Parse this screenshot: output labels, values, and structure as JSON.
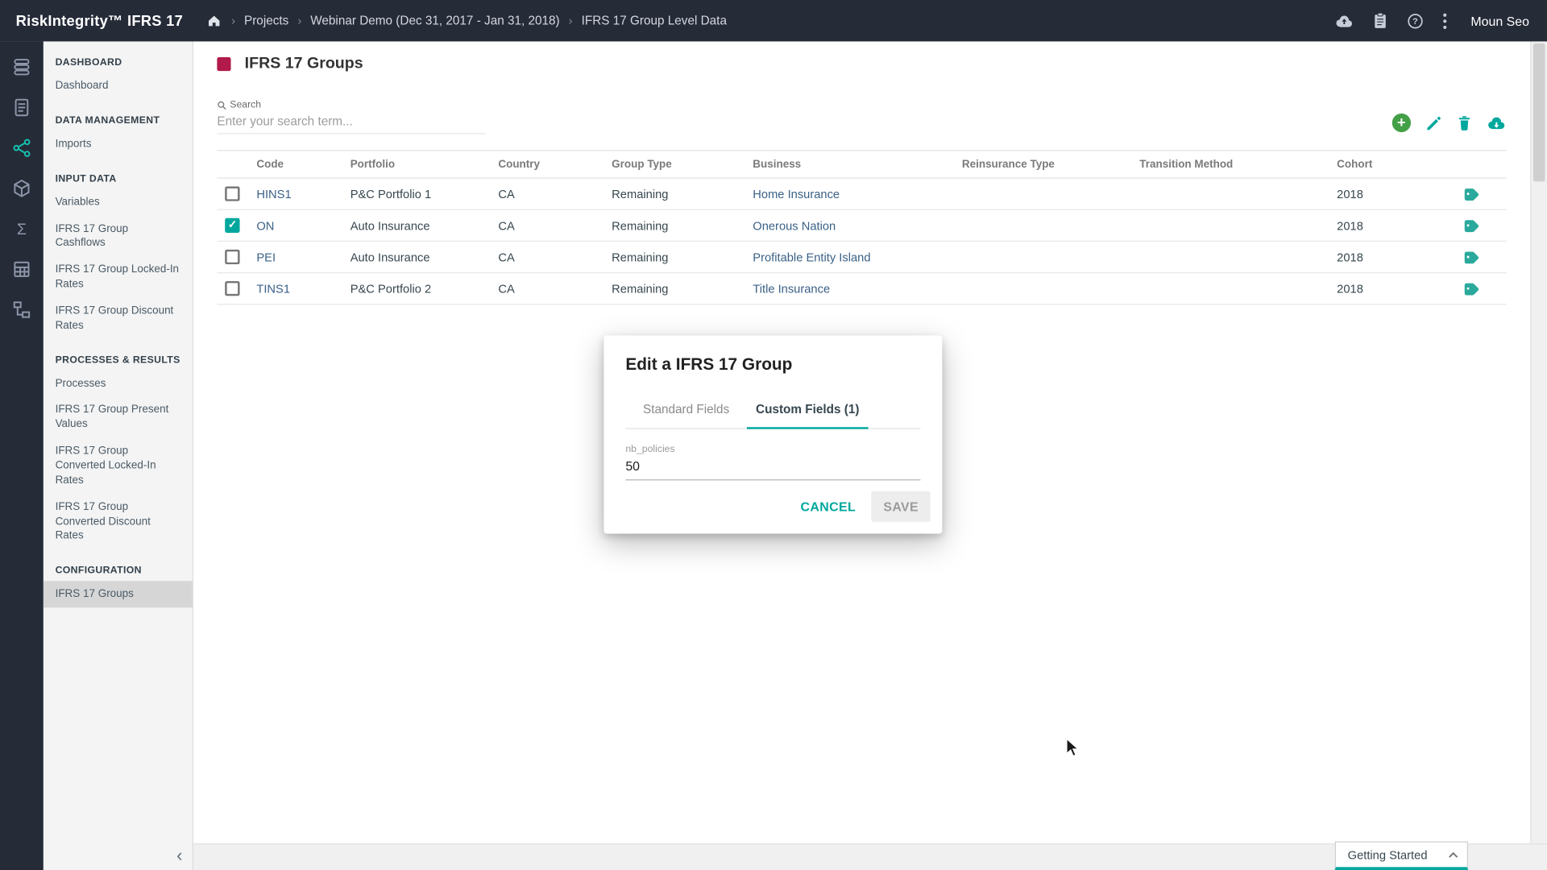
{
  "topbar": {
    "brand": "RiskIntegrity™ IFRS 17",
    "breadcrumb": [
      "Projects",
      "Webinar Demo (Dec 31, 2017 - Jan 31, 2018)",
      "IFRS 17 Group Level Data"
    ],
    "user": "Moun Seo",
    "icons": [
      "home-icon",
      "cloud-upload-icon",
      "clipboard-icon",
      "help-icon",
      "more-vertical-icon"
    ]
  },
  "rail": {
    "icons": [
      "data-sources-icon",
      "reports-icon",
      "data-management-icon",
      "input-data-icon",
      "sum-icon",
      "tables-icon",
      "workflow-icon"
    ],
    "active": "data-management-icon"
  },
  "sidebar": {
    "selected": "IFRS 17 Groups",
    "sections": [
      {
        "header": "DASHBOARD",
        "items": [
          "Dashboard"
        ]
      },
      {
        "header": "DATA MANAGEMENT",
        "items": [
          "Imports"
        ]
      },
      {
        "header": "INPUT DATA",
        "items": [
          "Variables",
          "IFRS 17 Group Cashflows",
          "IFRS 17 Group Locked-In Rates",
          "IFRS 17 Group Discount Rates"
        ]
      },
      {
        "header": "PROCESSES & RESULTS",
        "items": [
          "Processes",
          "IFRS 17 Group Present Values",
          "IFRS 17 Group Converted Locked-In Rates",
          "IFRS 17 Group Converted Discount Rates"
        ]
      },
      {
        "header": "CONFIGURATION",
        "items": [
          "IFRS 17 Groups"
        ]
      }
    ]
  },
  "page": {
    "title": "IFRS 17 Groups",
    "search_label": "Search",
    "search_placeholder": "Enter your search term...",
    "actions": [
      "add-button",
      "edit-button",
      "delete-button",
      "export-button"
    ]
  },
  "table": {
    "headers": [
      "Code",
      "Portfolio",
      "Country",
      "Group Type",
      "Business",
      "Reinsurance Type",
      "Transition Method",
      "Cohort"
    ],
    "rows": [
      {
        "checked": false,
        "code": "HINS1",
        "portfolio": "P&C Portfolio 1",
        "country": "CA",
        "group_type": "Remaining",
        "business": "Home Insurance",
        "reinsurance_type": "",
        "transition_method": "",
        "cohort": "2018"
      },
      {
        "checked": true,
        "code": "ON",
        "portfolio": "Auto Insurance",
        "country": "CA",
        "group_type": "Remaining",
        "business": "Onerous Nation",
        "reinsurance_type": "",
        "transition_method": "",
        "cohort": "2018"
      },
      {
        "checked": false,
        "code": "PEI",
        "portfolio": "Auto Insurance",
        "country": "CA",
        "group_type": "Remaining",
        "business": "Profitable Entity Island",
        "reinsurance_type": "",
        "transition_method": "",
        "cohort": "2018"
      },
      {
        "checked": false,
        "code": "TINS1",
        "portfolio": "P&C Portfolio 2",
        "country": "CA",
        "group_type": "Remaining",
        "business": "Title Insurance",
        "reinsurance_type": "",
        "transition_method": "",
        "cohort": "2018"
      }
    ]
  },
  "modal": {
    "title": "Edit a IFRS 17 Group",
    "tabs": [
      {
        "label": "Standard Fields",
        "active": false
      },
      {
        "label": "Custom Fields (1)",
        "active": true
      }
    ],
    "field_label": "nb_policies",
    "field_value": "50",
    "cancel_label": "CANCEL",
    "save_label": "SAVE"
  },
  "footer": {
    "getting_started": "Getting Started"
  },
  "colors": {
    "accent": "#00a79d",
    "add_green": "#43a047",
    "crimson": "#b11a4a",
    "topbar_bg": "#262b38",
    "link": "#3a6186"
  }
}
